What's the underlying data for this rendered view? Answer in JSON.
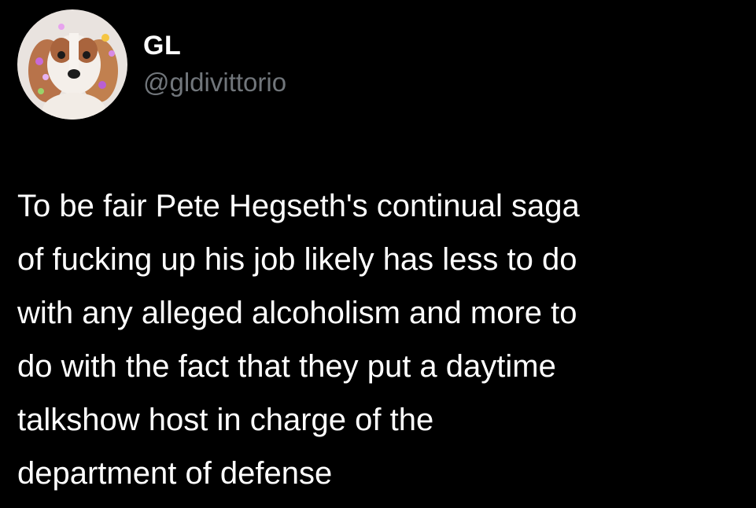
{
  "tweet": {
    "author": {
      "display_name": "GL",
      "handle": "@gldivittorio",
      "avatar_icon": "dog-avatar-icon"
    },
    "text": "To be fair Pete Hegseth's continual saga\nof fucking up his job likely has less to do\nwith any alleged alcoholism and more to\ndo with the fact that they put a daytime\ntalkshow host in charge of the\ndepartment of defense"
  },
  "colors": {
    "background": "#000000",
    "text_primary": "#ffffff",
    "text_secondary": "#71767b"
  }
}
